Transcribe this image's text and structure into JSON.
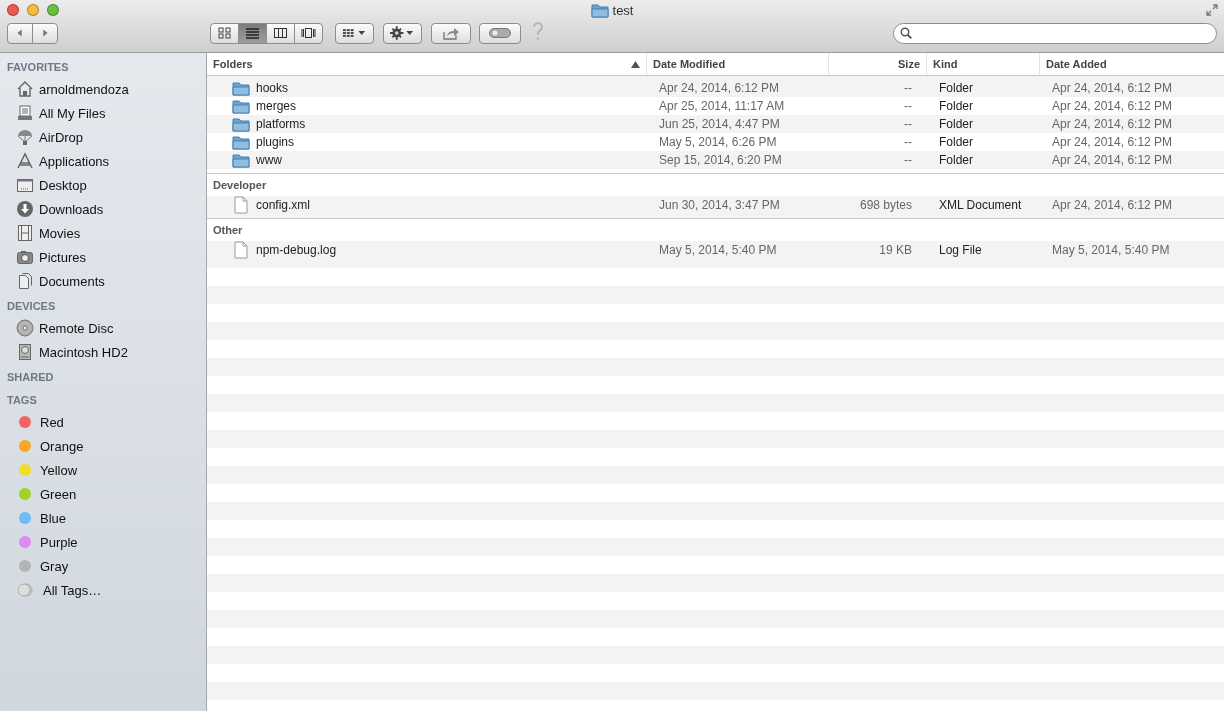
{
  "window": {
    "title": "test"
  },
  "toolbar": {
    "view_modes": [
      {
        "kind": "icons",
        "selected": false
      },
      {
        "kind": "list",
        "selected": true
      },
      {
        "kind": "columns",
        "selected": false
      },
      {
        "kind": "coverflow",
        "selected": false
      }
    ]
  },
  "sidebar": {
    "sections": [
      {
        "heading": "FAVORITES",
        "items": [
          {
            "label": "arnoldmendoza",
            "kind": "home"
          },
          {
            "label": "All My Files",
            "kind": "allfiles"
          },
          {
            "label": "AirDrop",
            "kind": "airdrop"
          },
          {
            "label": "Applications",
            "kind": "apps"
          },
          {
            "label": "Desktop",
            "kind": "desktop"
          },
          {
            "label": "Downloads",
            "kind": "downloads"
          },
          {
            "label": "Movies",
            "kind": "movies"
          },
          {
            "label": "Pictures",
            "kind": "pictures"
          },
          {
            "label": "Documents",
            "kind": "documents"
          }
        ]
      },
      {
        "heading": "DEVICES",
        "items": [
          {
            "label": "Remote Disc",
            "kind": "disc"
          },
          {
            "label": "Macintosh HD2",
            "kind": "drive"
          }
        ]
      },
      {
        "heading": "SHARED"
      },
      {
        "heading": "TAGS",
        "items": [
          {
            "label": "Red",
            "kind": "tag",
            "color": "#f26364"
          },
          {
            "label": "Orange",
            "kind": "tag",
            "color": "#f8a52c"
          },
          {
            "label": "Yellow",
            "kind": "tag",
            "color": "#f1dc2a"
          },
          {
            "label": "Green",
            "kind": "tag",
            "color": "#a2d22a"
          },
          {
            "label": "Blue",
            "kind": "tag",
            "color": "#6cbbf5"
          },
          {
            "label": "Purple",
            "kind": "tag",
            "color": "#de8af1"
          },
          {
            "label": "Gray",
            "kind": "tag",
            "color": "#b4b4b4"
          },
          {
            "label": "All Tags…",
            "kind": "alltags"
          }
        ]
      }
    ]
  },
  "file_list": {
    "columns": [
      {
        "label": "Folders",
        "sorted": true
      },
      {
        "label": "Date Modified",
        "sorted": false
      },
      {
        "label": "Size",
        "sorted": false
      },
      {
        "label": "Kind",
        "sorted": false
      },
      {
        "label": "Date Added",
        "sorted": false
      }
    ],
    "groups": [
      {
        "rows": [
          {
            "kind": "folder",
            "name": "hooks",
            "date_modified": "Apr 24, 2014, 6:12 PM",
            "size": "--",
            "type": "Folder",
            "date_added": "Apr 24, 2014, 6:12 PM"
          },
          {
            "kind": "folder",
            "name": "merges",
            "date_modified": "Apr 25, 2014, 11:17 AM",
            "size": "--",
            "type": "Folder",
            "date_added": "Apr 24, 2014, 6:12 PM"
          },
          {
            "kind": "folder",
            "name": "platforms",
            "date_modified": "Jun 25, 2014, 4:47 PM",
            "size": "--",
            "type": "Folder",
            "date_added": "Apr 24, 2014, 6:12 PM"
          },
          {
            "kind": "folder",
            "name": "plugins",
            "date_modified": "May 5, 2014, 6:26 PM",
            "size": "--",
            "type": "Folder",
            "date_added": "Apr 24, 2014, 6:12 PM"
          },
          {
            "kind": "folder",
            "name": "www",
            "date_modified": "Sep 15, 2014, 6:20 PM",
            "size": "--",
            "type": "Folder",
            "date_added": "Apr 24, 2014, 6:12 PM"
          }
        ]
      },
      {
        "heading": "Developer",
        "rows": [
          {
            "kind": "file",
            "name": "config.xml",
            "date_modified": "Jun 30, 2014, 3:47 PM",
            "size": "698 bytes",
            "type": "XML Document",
            "date_added": "Apr 24, 2014, 6:12 PM"
          }
        ]
      },
      {
        "heading": "Other",
        "rows": [
          {
            "kind": "file",
            "name": "npm-debug.log",
            "date_modified": "May 5, 2014, 5:40 PM",
            "size": "19 KB",
            "type": "Log File",
            "date_added": "May 5, 2014, 5:40 PM"
          }
        ]
      }
    ]
  }
}
